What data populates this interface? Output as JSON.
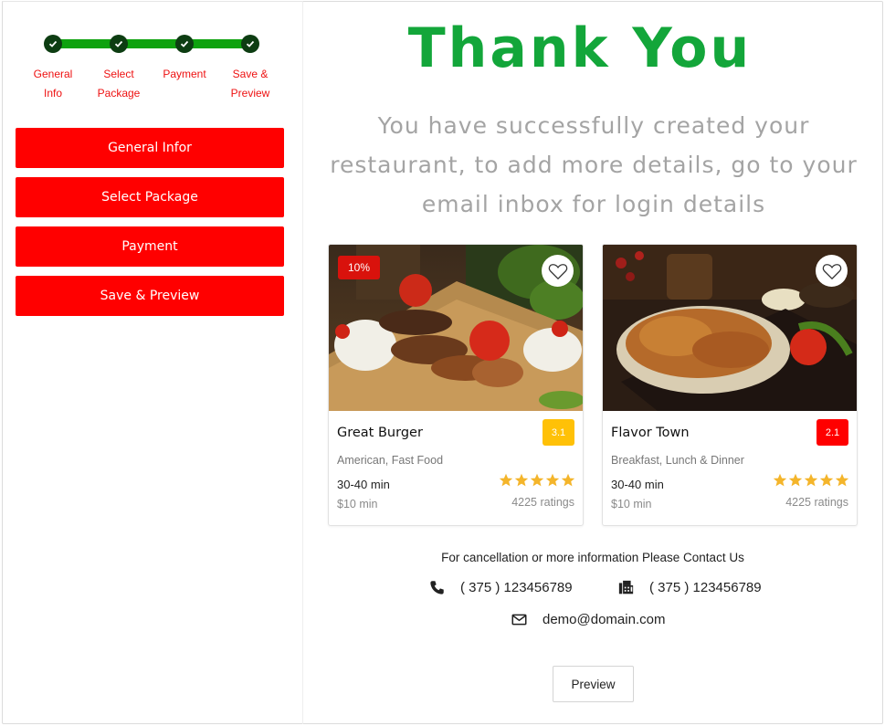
{
  "stepper": {
    "steps": [
      {
        "label_line1": "General",
        "label_line2": "Info"
      },
      {
        "label_line1": "Select",
        "label_line2": "Package"
      },
      {
        "label_line1": "Payment",
        "label_line2": ""
      },
      {
        "label_line1": "Save &",
        "label_line2": "Preview"
      }
    ],
    "completed_color": "#0ea20e"
  },
  "sidebar": {
    "buttons": [
      "General Infor",
      "Select Package",
      "Payment",
      "Save & Preview"
    ],
    "button_color": "#ff0000"
  },
  "header": {
    "title": "Thank You",
    "title_color": "#13a63a",
    "message_line1": "You have successfully created your",
    "message_line2": "restaurant, to add more details, go to your",
    "message_line3": "email inbox for login details"
  },
  "cards": [
    {
      "discount": "10%",
      "name": "Great Burger",
      "rating": "3.1",
      "rating_color": "#ffc107",
      "cuisine": "American, Fast Food",
      "time": "30-40 min",
      "min_price": "$10 min",
      "stars": 5,
      "ratings_count": "4225 ratings",
      "image_icon": "food-photo-icon"
    },
    {
      "discount": "",
      "name": "Flavor Town",
      "rating": "2.1",
      "rating_color": "#ff0000",
      "cuisine": "Breakfast, Lunch & Dinner",
      "time": "30-40 min",
      "min_price": "$10 min",
      "stars": 5,
      "ratings_count": "4225 ratings",
      "image_icon": "food-photo-icon"
    }
  ],
  "contact": {
    "intro": "For cancellation or more information Please Contact Us",
    "phone": "( 375 ) 123456789",
    "fax": "( 375 ) 123456789",
    "email": "demo@domain.com"
  },
  "preview_label": "Preview"
}
